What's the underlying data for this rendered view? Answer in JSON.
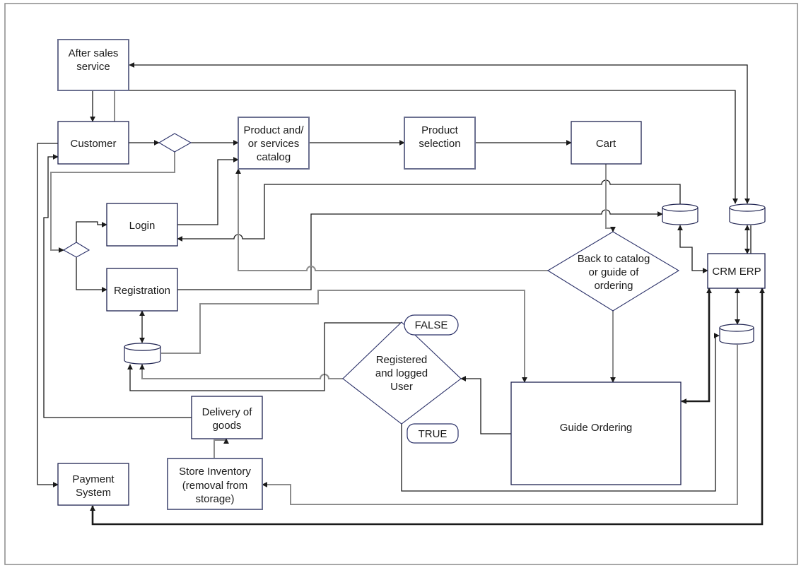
{
  "diagram": {
    "nodes": {
      "after_sales": {
        "lines": [
          "After sales",
          "service"
        ]
      },
      "customer": {
        "lines": [
          "Customer"
        ]
      },
      "catalog": {
        "lines": [
          "Product and/",
          "or services",
          "catalog"
        ]
      },
      "product_selection": {
        "lines": [
          "Product",
          "selection"
        ]
      },
      "cart": {
        "lines": [
          "Cart"
        ]
      },
      "login": {
        "lines": [
          "Login"
        ]
      },
      "registration": {
        "lines": [
          "Registration"
        ]
      },
      "back_to_catalog": {
        "lines": [
          "Back to catalog",
          "or guide of",
          "ordering"
        ]
      },
      "crm_erp": {
        "lines": [
          "CRM ERP"
        ]
      },
      "registered_user": {
        "lines": [
          "Registered",
          "and logged",
          "User"
        ]
      },
      "guide_ordering": {
        "lines": [
          "Guide Ordering"
        ]
      },
      "delivery": {
        "lines": [
          "Delivery of",
          "goods"
        ]
      },
      "store_inventory": {
        "lines": [
          "Store Inventory",
          "(removal from",
          "storage)"
        ]
      },
      "payment": {
        "lines": [
          "Payment",
          "System"
        ]
      }
    },
    "labels": {
      "false_label": "FALSE",
      "true_label": "TRUE"
    },
    "colors": {
      "shape_border": "#1e2250",
      "connector": "#1a1a1a",
      "connector_secondary": "#8c8c8c",
      "frame": "#8a8a8a"
    }
  }
}
